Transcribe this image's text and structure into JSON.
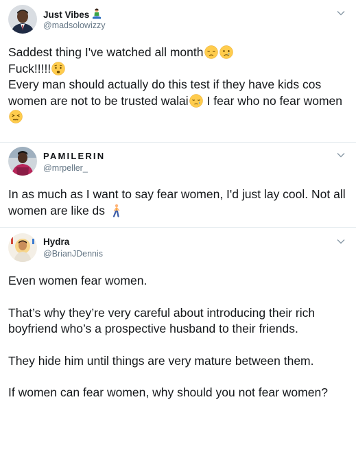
{
  "tweets": [
    {
      "name": "Just Vibes",
      "name_emoji": "person-in-lotus-position-icon",
      "handle": "@madsolowizzy",
      "lines": [
        {
          "parts": [
            {
              "t": "Saddest thing I've watched all month"
            },
            {
              "e": "pensive-face"
            },
            {
              "e": "crying-face"
            }
          ]
        },
        {
          "parts": [
            {
              "t": "Fuck!!!!!"
            },
            {
              "e": "worried-face"
            }
          ]
        },
        {
          "parts": [
            {
              "t": "Every man should actually do this test if they have kids cos women are not to be trusted walai"
            },
            {
              "e": "sleepy-face"
            },
            {
              "t": " I fear who no fear women "
            },
            {
              "e": "confounded-face"
            }
          ]
        }
      ]
    },
    {
      "name": "PAMILERIN",
      "handle": "@mrpeller_",
      "lines": [
        {
          "parts": [
            {
              "t": "In as much as I want to say fear women, I'd just lay cool. Not all women are like ds "
            },
            {
              "e": "person-walking"
            }
          ]
        }
      ]
    },
    {
      "name": "Hydra",
      "handle": "@BrianJDennis",
      "paragraphs": [
        "Even women fear women.",
        "That’s why they’re very careful about introducing their rich boyfriend who’s a prospective husband to their friends.",
        "They hide him until things are very mature between them.",
        "If women can fear women, why should you not fear women?"
      ]
    }
  ],
  "colors": {
    "text": "#14171a",
    "secondary": "#657786",
    "divider": "#e6ecf0",
    "emoji_yellow": "#ffcc4d",
    "tear_blue": "#5dadec"
  }
}
